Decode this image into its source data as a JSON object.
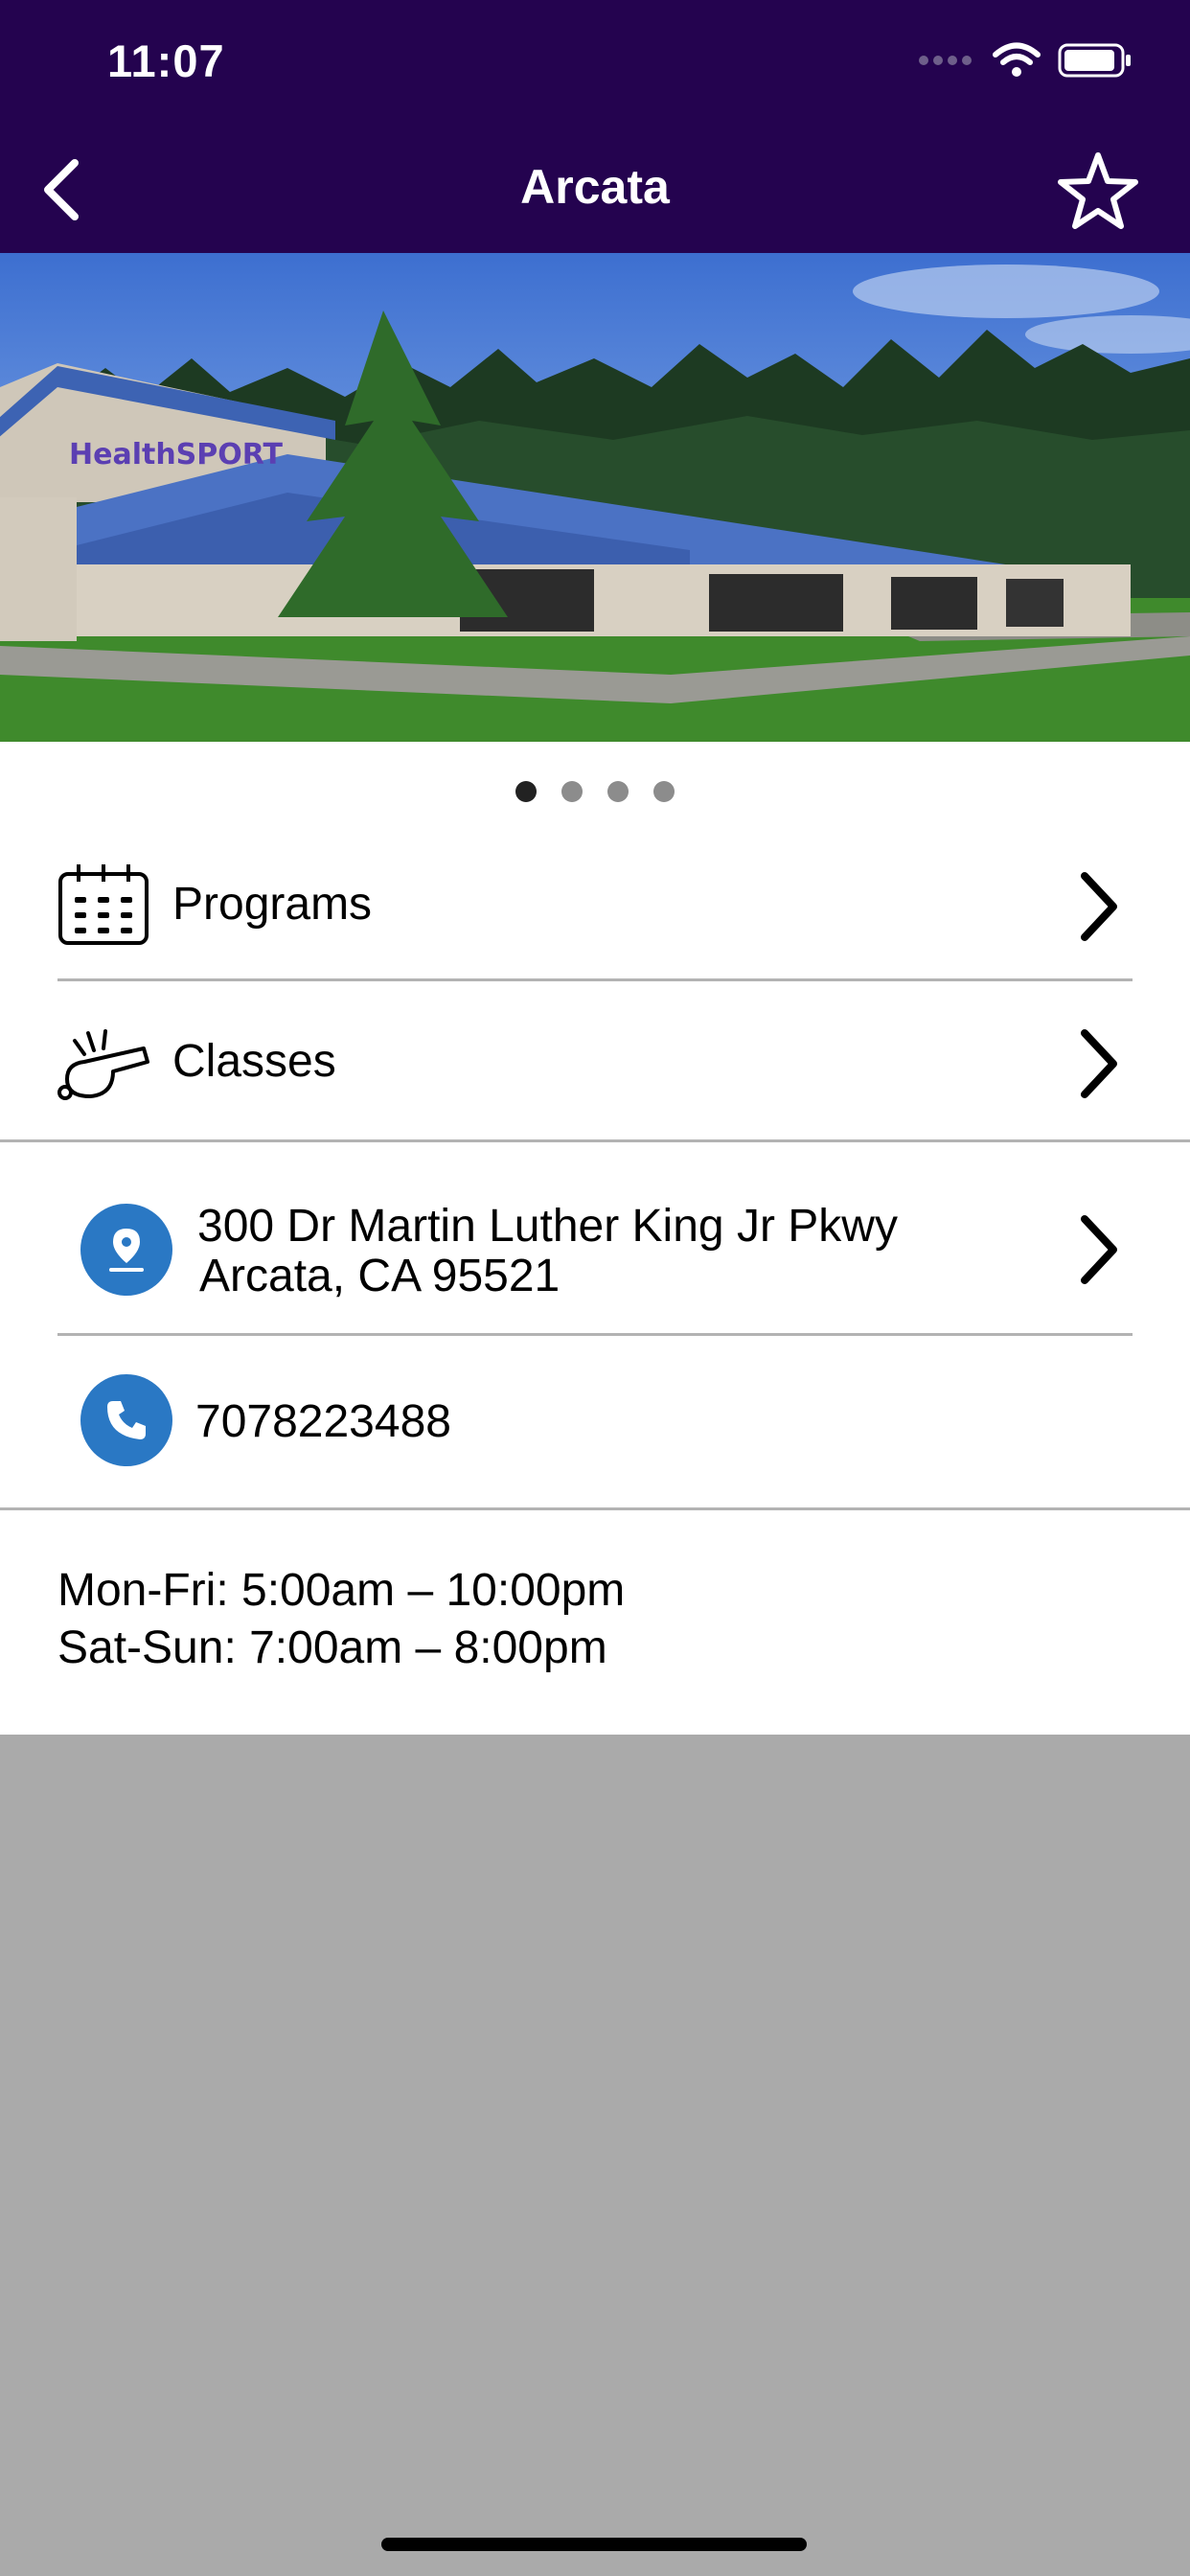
{
  "status_bar": {
    "time": "11:07"
  },
  "nav": {
    "title": "Arcata"
  },
  "hero": {
    "sign_text": "HealthSPORT",
    "page_count": 4,
    "active_page": 1
  },
  "menu": {
    "programs_label": "Programs",
    "classes_label": "Classes"
  },
  "contact": {
    "address_line1": "300 Dr Martin Luther King Jr Pkwy",
    "address_line2": "Arcata, CA 95521",
    "phone": "7078223488"
  },
  "hours": {
    "weekday": "Mon-Fri: 5:00am – 10:00pm",
    "weekend": "Sat-Sun: 7:00am – 8:00pm"
  },
  "colors": {
    "header_bg": "#24034f",
    "accent_blue": "#2a78c4",
    "empty_area": "#aaaaaa"
  }
}
